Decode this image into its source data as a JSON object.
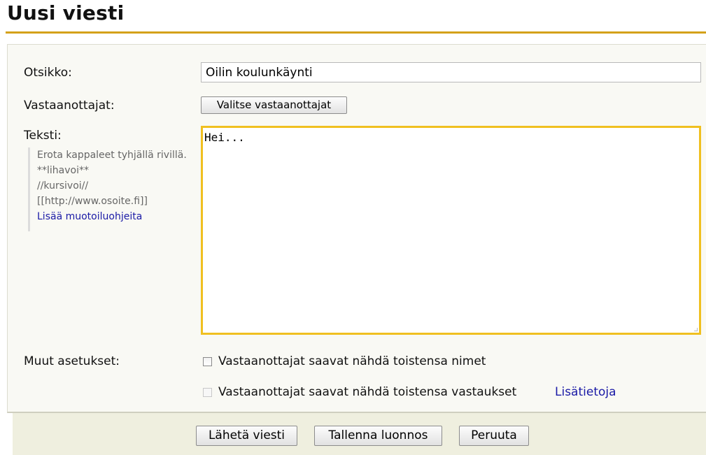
{
  "page": {
    "title": "Uusi viesti"
  },
  "form": {
    "subject_label": "Otsikko:",
    "subject_value": "Oilin koulunkäynti",
    "recipients_label": "Vastaanottajat:",
    "choose_recipients_button": "Valitse vastaanottajat",
    "text_label": "Teksti:",
    "text_value": "Hei...",
    "hints": {
      "paragraphs": "Erota kappaleet tyhjällä rivillä.",
      "bold": "**lihavoi**",
      "italic": "//kursivoi//",
      "link": "[[http://www.osoite.fi]]",
      "more_link": "Lisää muotoiluohjeita"
    },
    "other_settings_label": "Muut asetukset:",
    "options": [
      {
        "label": "Vastaanottajat saavat nähdä toistensa nimet",
        "checked": false,
        "enabled": true
      },
      {
        "label": "Vastaanottajat saavat nähdä toistensa vastaukset",
        "checked": false,
        "enabled": false
      }
    ],
    "more_info_link": "Lisätietoja"
  },
  "actions": {
    "send": "Lähetä viesti",
    "save_draft": "Tallenna luonnos",
    "cancel": "Peruuta"
  },
  "colors": {
    "accent_rule": "#d4a11a",
    "textarea_focus": "#f0c020",
    "link": "#1a1aa6",
    "panel_bg": "#f9f9f4",
    "footer_bg": "#efefdf"
  }
}
